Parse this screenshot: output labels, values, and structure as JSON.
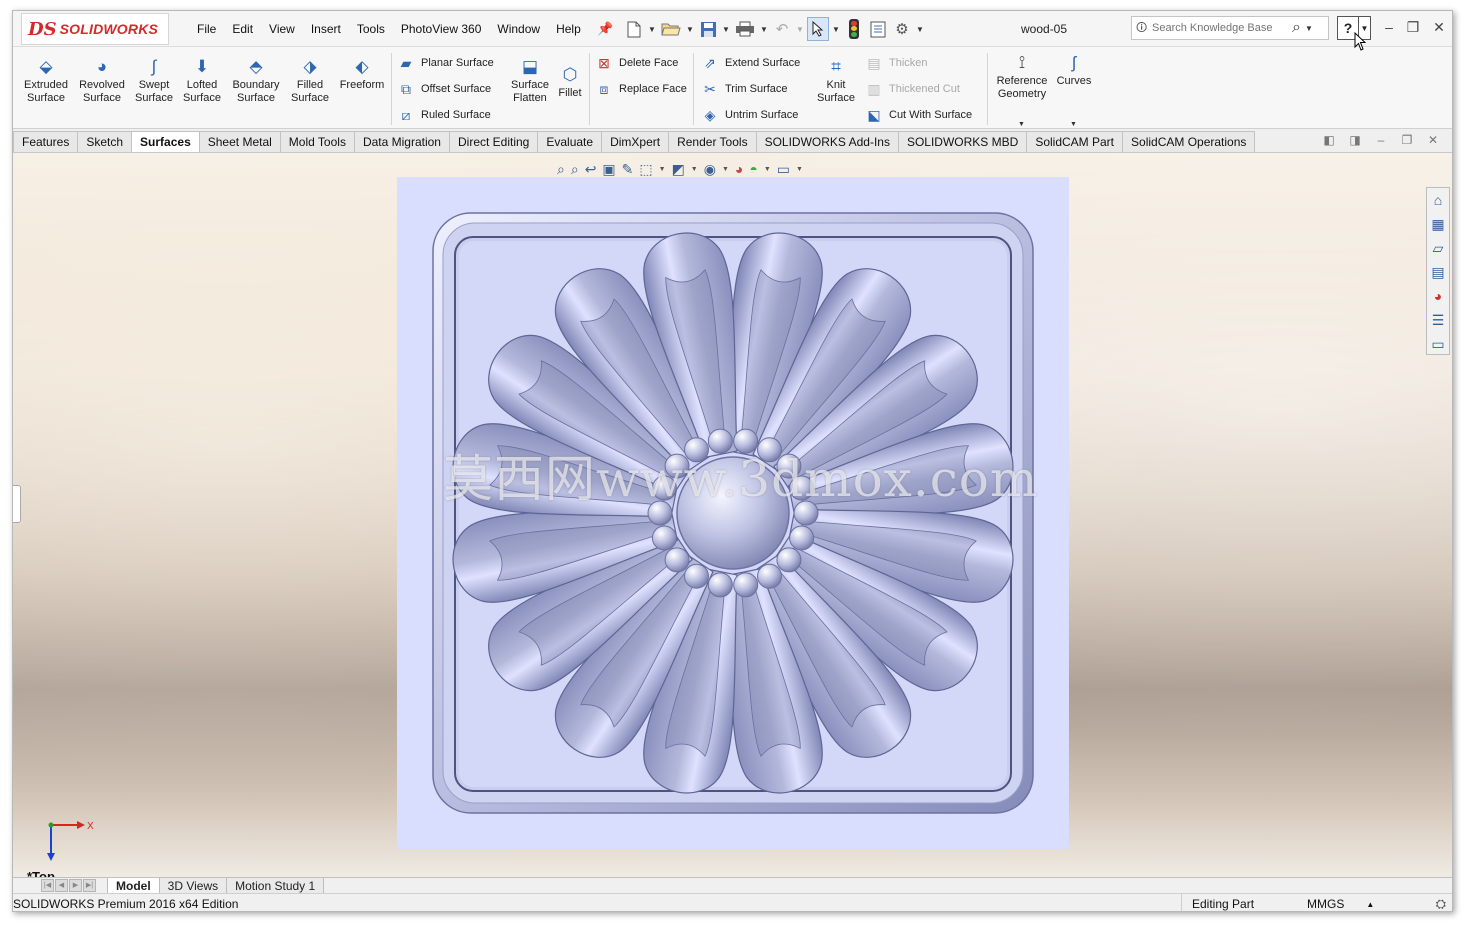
{
  "app": {
    "brand_ds": "DS",
    "brand_name": "SOLIDWORKS",
    "document_title": "wood-05"
  },
  "menu": [
    "File",
    "Edit",
    "View",
    "Insert",
    "Tools",
    "PhotoView 360",
    "Window",
    "Help"
  ],
  "quick_access": {
    "icons": [
      "new-document-icon",
      "open-icon",
      "save-icon",
      "print-icon",
      "undo-icon",
      "select-icon",
      "rebuild-icon",
      "file-properties-icon",
      "options-icon"
    ]
  },
  "search": {
    "placeholder": "Search Knowledge Base"
  },
  "help": {
    "label": "?"
  },
  "ribbon": {
    "big_buttons": [
      {
        "label": "Extruded Surface",
        "icon": "extruded-surface-icon"
      },
      {
        "label": "Revolved Surface",
        "icon": "revolved-surface-icon"
      },
      {
        "label": "Swept Surface",
        "icon": "swept-surface-icon"
      },
      {
        "label": "Lofted Surface",
        "icon": "lofted-surface-icon"
      },
      {
        "label": "Boundary Surface",
        "icon": "boundary-surface-icon"
      },
      {
        "label": "Filled Surface",
        "icon": "filled-surface-icon"
      },
      {
        "label": "Freeform",
        "icon": "freeform-icon"
      }
    ],
    "group2": [
      "Planar Surface",
      "Offset Surface",
      "Ruled Surface"
    ],
    "surface_flatten": "Surface Flatten",
    "fillet": "Fillet",
    "group3": [
      "Delete Face",
      "Replace Face"
    ],
    "group4": [
      "Extend Surface",
      "Trim Surface",
      "Untrim Surface"
    ],
    "knit_surface": "Knit Surface",
    "group5": [
      {
        "label": "Thicken",
        "enabled": false
      },
      {
        "label": "Thickened Cut",
        "enabled": false
      },
      {
        "label": "Cut With Surface",
        "enabled": true
      }
    ],
    "reference_geometry": "Reference Geometry",
    "curves": "Curves"
  },
  "tabs": [
    {
      "label": "Features",
      "active": false
    },
    {
      "label": "Sketch",
      "active": false
    },
    {
      "label": "Surfaces",
      "active": true
    },
    {
      "label": "Sheet Metal",
      "active": false
    },
    {
      "label": "Mold Tools",
      "active": false
    },
    {
      "label": "Data Migration",
      "active": false
    },
    {
      "label": "Direct Editing",
      "active": false
    },
    {
      "label": "Evaluate",
      "active": false
    },
    {
      "label": "DimXpert",
      "active": false
    },
    {
      "label": "Render Tools",
      "active": false
    },
    {
      "label": "SOLIDWORKS Add-Ins",
      "active": false
    },
    {
      "label": "SOLIDWORKS MBD",
      "active": false
    },
    {
      "label": "SolidCAM Part",
      "active": false
    },
    {
      "label": "SolidCAM Operations",
      "active": false
    }
  ],
  "viewport": {
    "watermark": "莫西网www.3dmox.com",
    "view_label": "*Top",
    "triad_x": "X",
    "model_color": "#aeb3d6",
    "plate_color": "#d9deff"
  },
  "bottom_tabs": [
    {
      "label": "Model",
      "active": true
    },
    {
      "label": "3D Views",
      "active": false
    },
    {
      "label": "Motion Study 1",
      "active": false
    }
  ],
  "status": {
    "edition": "SOLIDWORKS Premium 2016 x64 Edition",
    "mode": "Editing Part",
    "units": "MMGS"
  }
}
